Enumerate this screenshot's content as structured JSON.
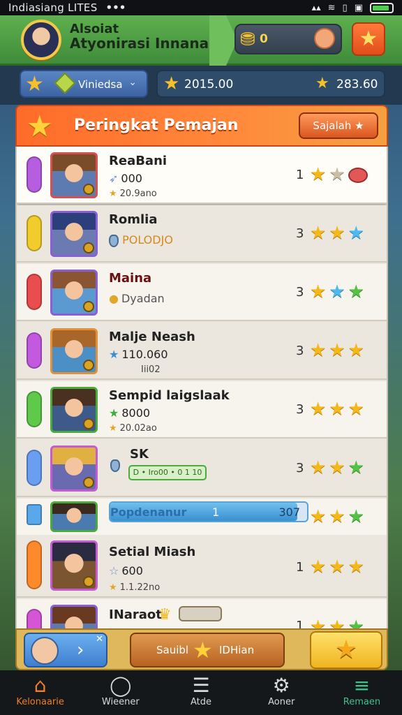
{
  "status_bar": {
    "carrier": "Indiasiang LITES",
    "dots": "•••"
  },
  "player": {
    "name_line1": "Alsoiat",
    "name_line2": "Atyonirasi Innanasi",
    "gold": "0"
  },
  "league": {
    "name": "Viniedsa"
  },
  "resources": {
    "value1": "2015.00",
    "value2": "283.60"
  },
  "leaderboard": {
    "title": "Peringkat Pemajan",
    "filter_label": "Sajalah ★",
    "rows": [
      {
        "name": "ReaBani",
        "stat1": "000",
        "stat2": "20.9ano",
        "rank": "1"
      },
      {
        "name": "Romlia",
        "stat1": "POLODJO"
      },
      {
        "name": "Maina",
        "stat1": "Dyadan"
      },
      {
        "name": "Malje Neash",
        "stat1": "110.060",
        "stat2": "Iii02"
      },
      {
        "name": "Sempid laigslaak",
        "stat1": "8000",
        "stat2": "20.02ao"
      },
      {
        "name": "SK",
        "stat1": "D • Iro00 • 0 1 10"
      },
      {
        "name": "Popdenanur",
        "progress_left": "1",
        "progress_right": "307",
        "progress_fraction": 0.95
      },
      {
        "name": "Setial Miash",
        "stat1": "600",
        "stat2": "1.1.22no",
        "rank": "1"
      },
      {
        "name": "INaraot",
        "rank": "1"
      }
    ]
  },
  "action_bar": {
    "mid_left": "Sauibl",
    "mid_right": "IDHian"
  },
  "nav": {
    "home": "Kelonaarie",
    "item2": "Wieener",
    "item3": "Atde",
    "item4": "Aoner",
    "item5": "Remaen"
  },
  "colors": {
    "accent": "#ff7a2e",
    "header_green": "#4fa246",
    "progress_blue": "#3a8fd0"
  }
}
